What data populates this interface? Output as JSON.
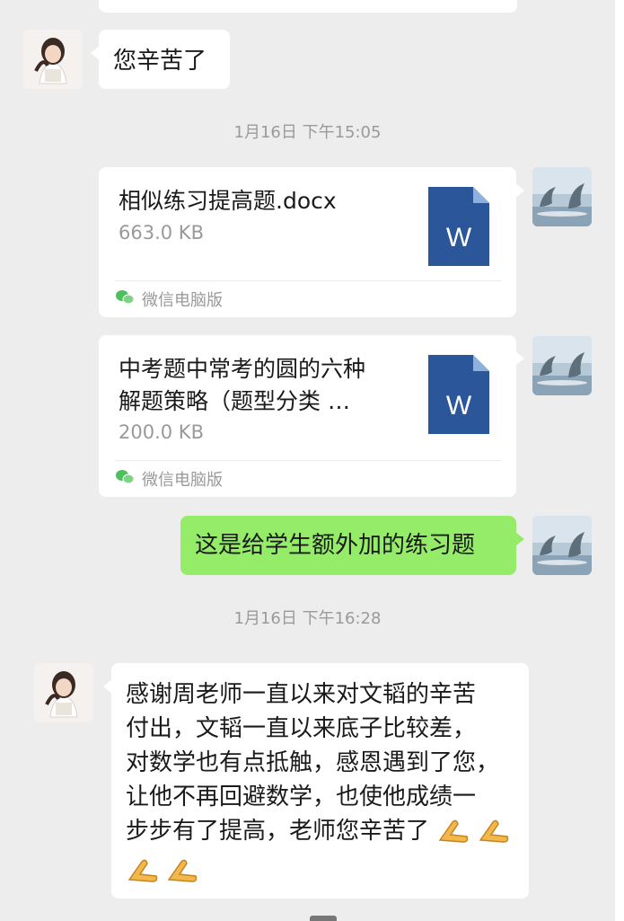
{
  "messages": {
    "reply_short": "您辛苦了",
    "timestamp1": "1月16日 下午15:05",
    "file1": {
      "name": "相似练习提高题.docx",
      "size": "663.0 KB",
      "source": "微信电脑版",
      "icon": "word-doc-icon"
    },
    "file2": {
      "name_line1": "中考题中常考的圆的六种",
      "name_line2": "解题策略（题型分类 …",
      "size": "200.0 KB",
      "source": "微信电脑版",
      "icon": "word-doc-icon"
    },
    "sent_text": "这是给学生额外加的练习题",
    "timestamp2": "1月16日 下午16:28",
    "long_reply": {
      "line1": "感谢周老师一直以来对文韬的辛苦",
      "line2": "付出，文韬一直以来底子比较差，",
      "line3": "对数学也有点抵触，感恩遇到了您，",
      "line4": "让他不再回避数学，也使他成绩一",
      "line5": "步步有了提高，老师您辛苦了"
    }
  },
  "colors": {
    "chat_background": "#ededed",
    "sent_bubble": "#95ec69",
    "received_bubble": "#ffffff",
    "word_blue": "#2b579a"
  }
}
